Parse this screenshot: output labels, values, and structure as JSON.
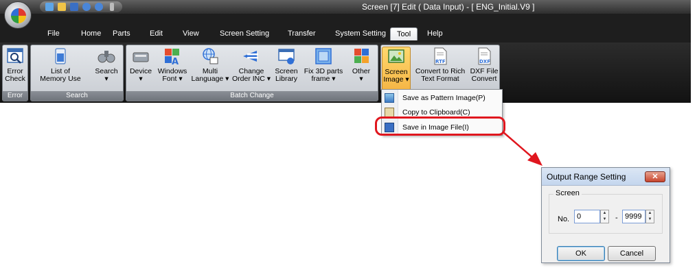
{
  "window": {
    "title": "Screen [7] Edit (      Data Input) - [ ENG_Initial.V9 ]"
  },
  "menu": {
    "items": [
      "File",
      "Home",
      "Parts",
      "Edit",
      "View",
      "Screen Setting",
      "Transfer",
      "System Setting",
      "Tool",
      "Help"
    ],
    "active": "Tool"
  },
  "ribbon": {
    "groups": {
      "error": {
        "label": "Error",
        "buttons": [
          {
            "label": "Error\nCheck",
            "icon": "error-check-icon"
          }
        ]
      },
      "search": {
        "label": "Search",
        "buttons": [
          {
            "label": "List of\nMemory Use",
            "icon": "memory-list-icon"
          },
          {
            "label": "Search\n▾",
            "icon": "binoculars-icon"
          }
        ]
      },
      "batch": {
        "label": "Batch Change",
        "buttons": [
          {
            "label": "Device\n▾",
            "icon": "device-icon"
          },
          {
            "label": "Windows\nFont ▾",
            "icon": "windows-font-icon"
          },
          {
            "label": "Multi\nLanguage ▾",
            "icon": "multi-language-icon"
          },
          {
            "label": "Change\nOrder INC ▾",
            "icon": "change-order-icon"
          },
          {
            "label": "Screen\nLibrary",
            "icon": "screen-library-icon"
          },
          {
            "label": "Fix 3D parts\nframe ▾",
            "icon": "fix-3d-frame-icon"
          },
          {
            "label": "Other\n▾",
            "icon": "other-icon"
          }
        ]
      },
      "tool": {
        "label": "",
        "buttons": [
          {
            "label": "Screen\nImage ▾",
            "icon": "screen-image-icon"
          },
          {
            "label": "Convert to Rich\nText Format",
            "icon": "rtf-file-icon"
          },
          {
            "label": "DXF File\nConvert",
            "icon": "dxf-file-icon"
          }
        ]
      }
    }
  },
  "dropdown": {
    "items": [
      {
        "label": "Save as Pattern Image(P)",
        "icon": "pattern-image-icon"
      },
      {
        "label": "Copy to Clipboard(C)",
        "icon": "clipboard-icon"
      },
      {
        "label": "Save in Image File(I)",
        "icon": "save-image-file-icon"
      }
    ]
  },
  "dialog": {
    "title": "Output Range Setting",
    "close_label": "✕",
    "group_label": "Screen",
    "no_label": "No.",
    "from_value": "0",
    "range_separator": "-",
    "to_value": "9999",
    "ok_label": "OK",
    "cancel_label": "Cancel"
  },
  "colors": {
    "annotation_red": "#e0161e",
    "titlebar_dark": "#2e2e2e",
    "ribbon_group_bg": "#d6d9de"
  }
}
